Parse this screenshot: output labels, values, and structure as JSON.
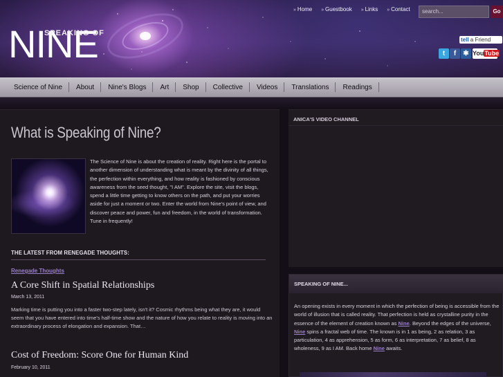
{
  "header": {
    "logo_sub": "SPEAKING OF",
    "logo_main": "NINE",
    "top_links": [
      "Home",
      "Guestbook",
      "Links",
      "Contact"
    ],
    "search_placeholder": "search...",
    "search_button": "Go",
    "tell_a_friend": "a Friend",
    "social": [
      "twitter-icon",
      "facebook-icon",
      "myspace-icon",
      "youtube-icon"
    ],
    "youtube_label": "You",
    "youtube_label_tube": "Tube"
  },
  "nav": {
    "items": [
      "Science of Nine",
      "About",
      "Nine's Blogs",
      "Art",
      "Shop",
      "Collective",
      "Videos",
      "Translations",
      "Readings"
    ]
  },
  "main": {
    "title": "What is Speaking of Nine?",
    "intro": "The Science of Nine is about the creation of reality. Right here is the portal to another dimension of understanding what is meant by the divinity of all things, the perfection within everything, and how reality is fashioned by conscious awareness from the seed thought, \"I AM\". Explore the site, visit the blogs, spend a little time getting to know others on the path, and put your worries aside for just a moment or two. Enter the world from Nine's point of view, and discover peace and power, fun and freedom, in the world of transformation. Tune in frequently!",
    "latest_heading": "THE LATEST FROM RENEGADE THOUGHTS:",
    "category_link": "Renegade Thoughts",
    "posts": [
      {
        "title": "A Core Shift in Spatial Relationships",
        "date": "March 13, 2011",
        "excerpt": "Marking time is putting you into a faster two-step lately, isn't it? Cosmic rhythms being what they are, it would seem that you have entered into time's half-time show and the nature of how you relate to reality is moving into an extraordinary process of elongation and expansion. That…"
      },
      {
        "title": "Cost of Freedom: Score One for Human Kind",
        "date": "February 10, 2011"
      }
    ]
  },
  "sidebar": {
    "video_heading": "ANICA'S VIDEO CHANNEL",
    "about_heading": "SPEAKING OF NINE...",
    "about_text_1": "An opening exists in every moment in which the perfection of being is accessible from the world of illusion that is called reality. That perfection is held as crystalline purity in the essence of the element of creation known as ",
    "about_link_1": "Nine",
    "about_text_2": ". Beyond the edges of the universe, ",
    "about_link_2": "Nine",
    "about_text_3": " spins a fractal web of time. The known is in 1 as being, 2 as relation, 3 as particulation, 4 as apprehension, 5 as form, 6 as interpretation, 7 as belief, 8 as wholeness, 9 as I AM. Back home ",
    "about_link_3": "Nine",
    "about_text_4": " awaits."
  },
  "colors": {
    "accent_link": "#9a80c8",
    "nav_bg": "#b3aeb8",
    "page_bg": "#140f16"
  }
}
